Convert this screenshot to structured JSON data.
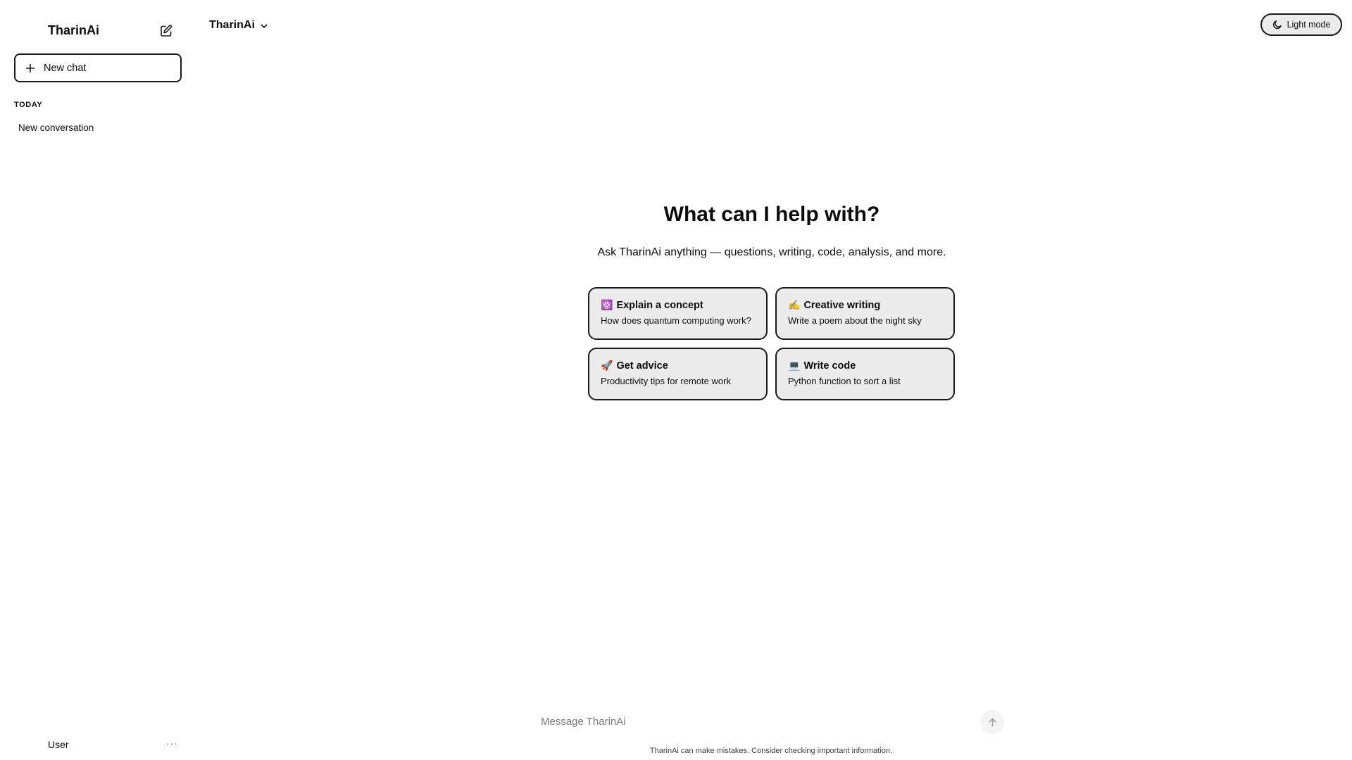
{
  "sidebar": {
    "title": "TharinAi",
    "new_chat_label": "New chat",
    "section_label": "TODAY",
    "conversations": [
      {
        "label": "New conversation"
      }
    ],
    "user_label": "User",
    "more_label": "···"
  },
  "header": {
    "model_name": "TharinAi",
    "theme_label": "Light mode"
  },
  "main": {
    "title": "What can I help with?",
    "subtitle": "Ask TharinAi anything — questions, writing, code, analysis, and more.",
    "cards": [
      {
        "emoji": "⚛️",
        "title": "Explain a concept",
        "subtitle": "How does quantum computing work?"
      },
      {
        "emoji": "✍️",
        "title": "Creative writing",
        "subtitle": "Write a poem about the night sky"
      },
      {
        "emoji": "🚀",
        "title": "Get advice",
        "subtitle": "Productivity tips for remote work"
      },
      {
        "emoji": "💻",
        "title": "Write code",
        "subtitle": "Python function to sort a list"
      }
    ]
  },
  "composer": {
    "placeholder": "Message TharinAi",
    "value": "",
    "disclaimer": "TharinAi can make mistakes. Consider checking important information."
  },
  "icons": {
    "edit": "edit-icon",
    "plus": "plus-icon",
    "chevron": "chevron-down-icon",
    "moon": "moon-icon",
    "send": "arrow-up-icon"
  }
}
